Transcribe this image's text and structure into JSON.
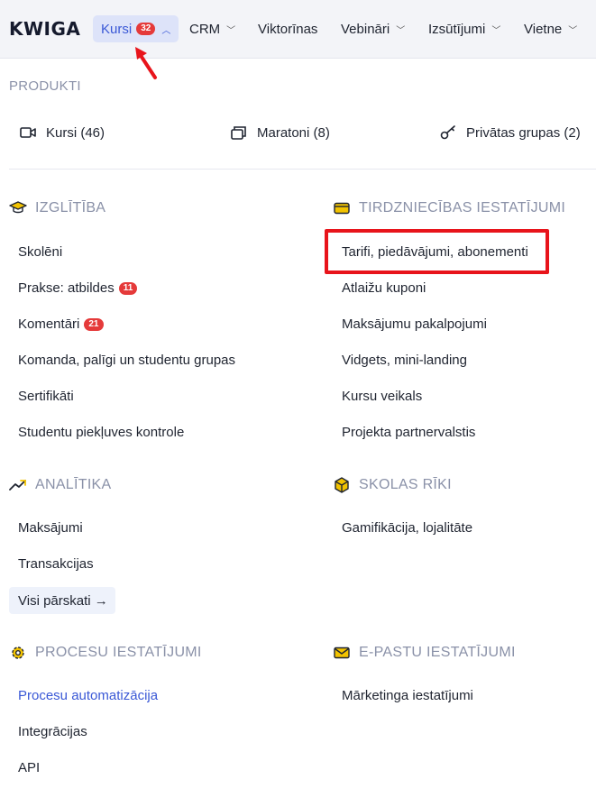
{
  "app": {
    "logo": "KWIGA"
  },
  "nav": {
    "courses": {
      "label": "Kursi",
      "count": "32"
    },
    "crm": {
      "label": "CRM"
    },
    "quizzes": {
      "label": "Viktorīnas"
    },
    "webinars": {
      "label": "Vebināri"
    },
    "mailings": {
      "label": "Izsūtījumi"
    },
    "site": {
      "label": "Vietne"
    }
  },
  "products": {
    "heading": "PRODUKTI",
    "courses": "Kursi (46)",
    "marathons": "Maratoni (8)",
    "private_groups": "Privātas grupas (2)"
  },
  "education": {
    "title": "IZGLĪTĪBA",
    "items": [
      {
        "label": "Skolēni"
      },
      {
        "label": "Prakse: atbildes",
        "badge": "11"
      },
      {
        "label": "Komentāri",
        "badge": "21"
      },
      {
        "label": "Komanda, palīgi un studentu grupas"
      },
      {
        "label": "Sertifikāti"
      },
      {
        "label": "Studentu piekļuves kontrole"
      }
    ]
  },
  "trade": {
    "title": "TIRDZNIECĪBAS IESTATĪJUMI",
    "items": [
      {
        "label": "Tarifi, piedāvājumi, abonementi"
      },
      {
        "label": "Atlaižu kuponi"
      },
      {
        "label": "Maksājumu pakalpojumi"
      },
      {
        "label": "Vidgets, mini-landing"
      },
      {
        "label": "Kursu veikals"
      },
      {
        "label": "Projekta partnervalstis"
      }
    ]
  },
  "analytics": {
    "title": "ANALĪTIKA",
    "items": [
      {
        "label": "Maksājumi"
      },
      {
        "label": "Transakcijas"
      }
    ],
    "all_reports": "Visi pārskati →"
  },
  "school_tools": {
    "title": "SKOLAS RĪKI",
    "items": [
      {
        "label": "Gamifikācija, lojalitāte"
      }
    ]
  },
  "process": {
    "title": "PROCESU IESTATĪJUMI",
    "items": [
      {
        "label": "Procesu automatizācija"
      },
      {
        "label": "Integrācijas"
      },
      {
        "label": "API"
      }
    ]
  },
  "email": {
    "title": "E-PASTU IESTATĪJUMI",
    "items": [
      {
        "label": "Mārketinga iestatījumi"
      }
    ]
  },
  "colors": {
    "accent": "#3a58d6",
    "badge": "#e53a3a",
    "highlight": "#e8141b",
    "icon_yellow": "#f2c300"
  }
}
